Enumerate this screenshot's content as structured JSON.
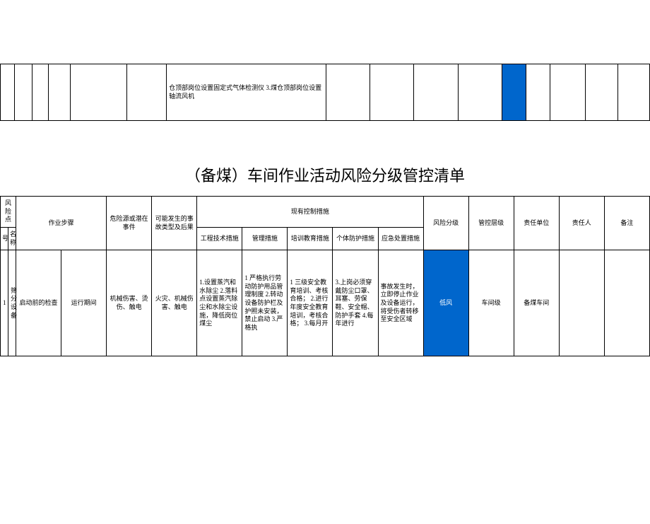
{
  "top_fragment": {
    "cell_text": "仓顶部岗位设置固定式气体检测仪 3.煤仓顶部岗位设置轴流风机"
  },
  "title": "（备煤）车间作业活动风险分级管控清单",
  "headers": {
    "risk_point": "风险点",
    "no": "号",
    "name": "名称",
    "step": "作业步骤",
    "hazard": "危险源或潜在事件",
    "accident": "可能发生的事故类型及后果",
    "controls": "现有控制措施",
    "engineering": "工程技术措施",
    "management": "管理措施",
    "training": "培训教育措施",
    "ppe": "个体防护措施",
    "emergency": "应急处置措施",
    "risk_level": "风险分级",
    "ctrl_level": "管控层级",
    "resp_unit": "责任单位",
    "resp_person": "责任人",
    "remark": "备注"
  },
  "row": {
    "no": "1",
    "name": "筛分设备",
    "step1": "启动前的检查",
    "step2": "运行期间",
    "hazard": "机械伤害、烫伤、触电",
    "accident": "火灾、机械伤害、触电",
    "engineering": "1.设置蒸汽和水除尘 2.落料点设置蒸汽除尘和水除尘设施，降低岗位煤尘",
    "management": "1 严格执行劳动防护用品管理制度\n2.转动设备防护栏及护照未安装，禁止启动\n3.严格执",
    "training": "1 三级安全教育培训、考核合格；\n2.进行年度安全教育培训，考核合格；\n3.每月开",
    "ppe": "3.上岗必须穿戴防尘口罩、耳塞、劳保鞋、安全帽、防护手套\n4.每年进行",
    "emergency": "事故发生时，立即停止作业及设备运行，将受伤者转移至安全区域",
    "risk_level": "低风",
    "ctrl_level": "车间级",
    "resp_unit": "备煤车间"
  }
}
